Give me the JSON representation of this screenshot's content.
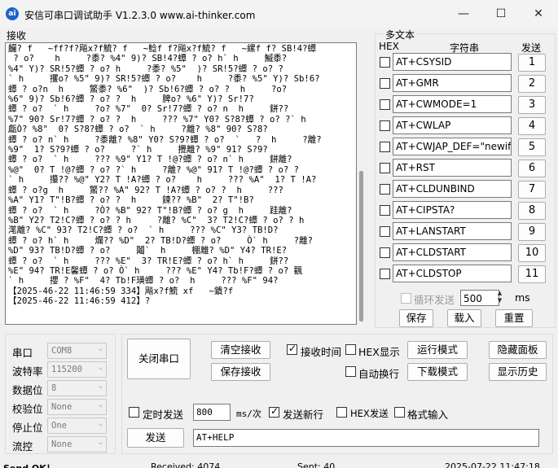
{
  "window": {
    "icon": "ai",
    "title": "安信可串口调试助手 V1.2.3.0    www.ai-thinker.com",
    "minimize": "—",
    "maximize": "☐",
    "close": "✕"
  },
  "receive": {
    "group_title": "接收",
    "text": "麣? f   ~ff?f?飚x?f鯍? f   ~鯰f f?飚x?f鯍? f   ~縲f f? SB!4?蟫\n ? o?    h     ?黍? %4\" 9)? SB!4?蟫 ? o? h` h     鰄黍?\n%4\" Y)? SR!5?蟫 ? o? h     ?黍? %5\"  )? SR!5?蟫 ? o? ?\n` h     攫o? %5\" 9)? SR!5?蟫 ? o?    h     ?黍? %5\" Y)? Sb!6?\n蟫 ? o?n  h     鰵黍? %6\"  )? Sb!6?蟫 ? o? ?  h     ?o?\n%6\" 9)? Sb!6?蟫 ? o? ?  h     脾o? %6\" Y)? Sr!7?\n蟫 ? o?  ` h     ?o? %7\"  0? Sr!7?蟫 ? o? n  h     鉼??\n%7\" 90? Sr!7?蟫 ? o? ?  h     ??? %7\" Y0? S?8?蟫 ? o? ?` h\n甗Ò? %8\"  0? S?8?蟫 ? o?  ` h     ?離? %8\" 90? S?8?\n蟫 ? o? n` h     ?黍離? %8\" Y0? S?9?蟫 ? o?  `   ?  h     ?離?\n%9\"  1? S?9?蟫 ? o?     ?` h     攪離? %9\" 91? S?9?\n蟫 ? o?  ` h     ??? %9\" Y1? T !@?蟫 ? o? n` h     鉼離?\n%@\"  0? T !@?蟫 ? o? ?` h     ?離? %@\" 91? T !@?蟫 ? o? ?\n` h     攥?? %@\" Y2? T !A?蟫 ? o?    h     ??? %A\"  1? T !A?\n蟫 ? o?g  h     鰵?? %A\" 92? T !A?蟫 ? o? ?  h     ???\n%A\" Y1? T\"!B?蟫 ? o? ?  h     鍊?? %B\"  2? T\"!B?\n蟫 ? o?  ` h     ?Ò? %B\" 92? T\"!B?蟫 ? o? g  h     跬離?\n%B\" Y2? T2!C?蟫 ? o? ? h     ?離? %C\"  3? T2!C?蟫 ? o? ? h\n滗離? %C\" 93? T2!C?蟫 ? o?  ` h     ??? %C\" Y3? TB!D?\n蟫 ? o? h` h     爛?? %D\"  2? TB!D?蟫 ? o?     Ò` h     ?離?\n%D\" 93? TB!D?蟫 ? o?     鬮`  h     棚離? %D\" Y4? TR!E?\n蟫 ? o?  ` h     ??? %E\"  3? TR!E?蟫 ? o? h` h     鉼??\n%E\" 94? TR!E馨蟫 ? o? Ò` h     ??? %E\" Y4? Tb!F?蟫 ? o? 飌\n` h     攖 ? %F\"  4? Tb!F璜蟫 ? o?  h     ??? %F\" 94?\n【2025-46-22 11:46:59 334】飚x?f鯍 xf   ~鐀?f\n【2025-46-22 11:46:59 412】?"
  },
  "multitext": {
    "group_title": "多文本",
    "col_hex": "HEX",
    "col_string": "字符串",
    "col_send": "发送",
    "items": [
      {
        "text": "AT+CSYSID",
        "num": "1"
      },
      {
        "text": "AT+GMR",
        "num": "2"
      },
      {
        "text": "AT+CWMODE=1",
        "num": "3"
      },
      {
        "text": "AT+CWLAP",
        "num": "4"
      },
      {
        "text": "AT+CWJAP_DEF=\"newifi_",
        "num": "5"
      },
      {
        "text": "AT+RST",
        "num": "6"
      },
      {
        "text": "AT+CLDUNBIND",
        "num": "7"
      },
      {
        "text": "AT+CIPSTA?",
        "num": "8"
      },
      {
        "text": "AT+LANSTART",
        "num": "9"
      },
      {
        "text": "AT+CLDSTART",
        "num": "10"
      },
      {
        "text": "AT+CLDSTOP",
        "num": "11"
      }
    ],
    "loop_send_label": "循环发送",
    "loop_interval": "500",
    "ms_label": "ms",
    "save_label": "保存",
    "load_label": "载入",
    "reset_label": "重置"
  },
  "port": {
    "port_label": "串口",
    "port_value": "COM8",
    "baud_label": "波特率",
    "baud_value": "115200",
    "databits_label": "数据位",
    "databits_value": "8",
    "parity_label": "校验位",
    "parity_value": "None",
    "stopbits_label": "停止位",
    "stopbits_value": "One",
    "flow_label": "流控",
    "flow_value": "None"
  },
  "controls": {
    "close_port_label": "关闭串口",
    "clear_recv_label": "清空接收",
    "save_recv_label": "保存接收",
    "recv_time_label": "接收时间",
    "hex_display_label": "HEX显示",
    "auto_newline_label": "自动换行",
    "run_mode_label": "运行模式",
    "download_mode_label": "下载模式",
    "hide_panel_label": "隐藏面板",
    "show_history_label": "显示历史",
    "timed_send_label": "定时发送",
    "timed_interval": "800",
    "ms_per_label": "ms/次",
    "send_newline_label": "发送新行",
    "hex_send_label": "HEX发送",
    "format_input_label": "格式输入",
    "send_label": "发送",
    "send_text": "AT+HELP"
  },
  "status": {
    "send_ok": "Send OK！",
    "received": "Received: 4074",
    "sent": "Sent: 40",
    "datetime": "2025-07-22 11:47:18"
  }
}
